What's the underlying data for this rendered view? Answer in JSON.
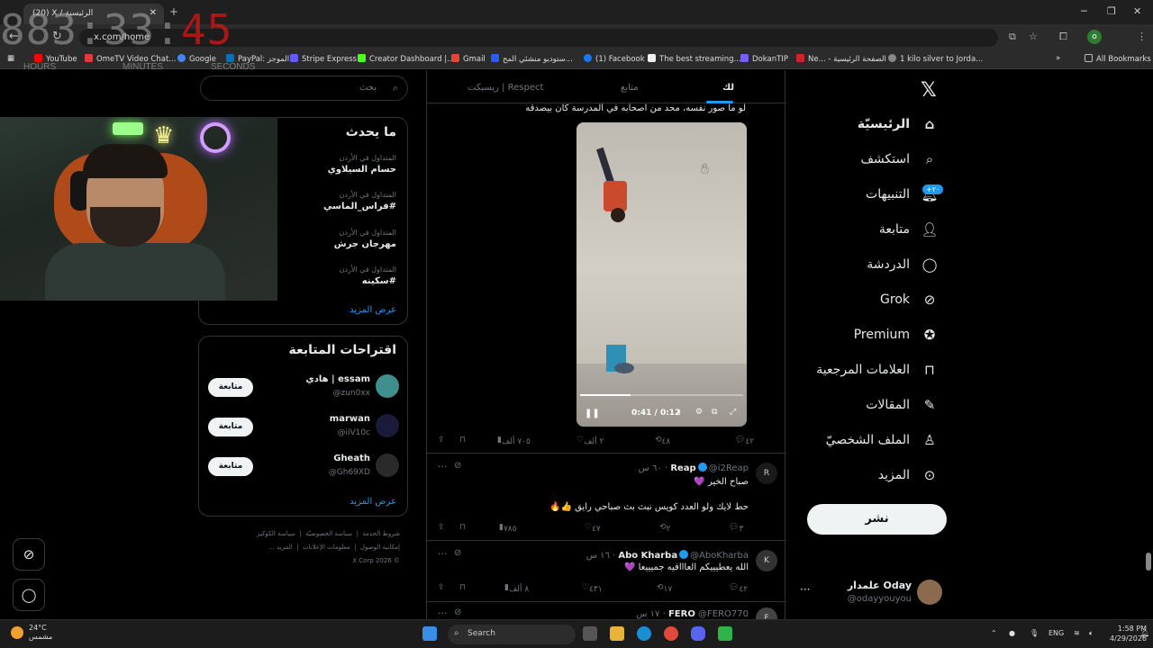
{
  "browser": {
    "tab_title": "(20) X / الرئيسية",
    "url": "x.com/home",
    "bookmarks": [
      "YouTube",
      "OmeTV Video Chat...",
      "Google",
      "PayPal: الموجز",
      "Stripe Express",
      "Creator Dashboard |...",
      "Gmail",
      "ستوديو منشئي المح...",
      "(1) Facebook",
      "The best streaming...",
      "DokanTIP",
      "Ne... - الصفحة الرئيسية",
      "1 kilo silver to Jorda..."
    ],
    "all_bookmarks": "All Bookmarks",
    "profile_letter": "o"
  },
  "timer": {
    "hm": "883:33:",
    "sec": "45",
    "labels": [
      "HOURS",
      "MINUTES",
      "SECONDS"
    ]
  },
  "nav": {
    "items": [
      "الرئيسيّة",
      "استكشف",
      "التنبيهات",
      "متابعة",
      "الدردشة",
      "Grok",
      "Premium",
      "العلامات المرجعية",
      "المقالات",
      "الملف الشخصيّ",
      "المزيد"
    ],
    "notif_badge": "+٢٠",
    "post_button": "نشر",
    "account_name": "علمدار Oday",
    "account_handle": "@odayyouyou"
  },
  "feed": {
    "tabs": [
      "لك",
      "متابع",
      "ريسبكت | Respect"
    ],
    "caption": "لو ما صور نفسه، محد من اصحابه في المدرسة كان بيصدقه",
    "video_time": "0:41 / 0:12",
    "tweet1_stats": {
      "replies": "٤٢",
      "reposts": "٤٨",
      "likes": "٢ ألف",
      "views": "٧٠٥ ألف"
    },
    "tweets": [
      {
        "name": "Reap",
        "handle": "@i2Reap · ٦٠ س",
        "avatar": "R",
        "lines": [
          "صباح الخير 💜",
          "حط لايك ولو العدد كويس نبث بث صباحي رايق 👍🔥"
        ],
        "stats": {
          "replies": "٣",
          "reposts": "٢",
          "likes": "٤٧",
          "views": "٧٨٥"
        }
      },
      {
        "name": "Abo Kharba",
        "handle": "@AboKharba · ١٦ س",
        "avatar": "K",
        "lines": [
          "الله يعطيييكم العااافيه جميييعا 💜"
        ],
        "stats": {
          "replies": "٤٢",
          "reposts": "١٧",
          "likes": "٤٣١",
          "views": "٨ ألف"
        }
      },
      {
        "name": "FERO",
        "handle": "@FERO770 · ١٧ س",
        "avatar": "F",
        "lines": [],
        "stats": {}
      }
    ]
  },
  "sidebar": {
    "search_placeholder": "بحث",
    "trends_title": "ما يحدث",
    "trends": [
      {
        "context": "المتداول في الأردن",
        "topic": "حسام السيلاوي"
      },
      {
        "context": "المتداول في الأردن",
        "topic": "#فراس_الماسي"
      },
      {
        "context": "المتداول في الأردن",
        "topic": "مهرجان جرش"
      },
      {
        "context": "المتداول في الأردن",
        "topic": "#سكينه"
      }
    ],
    "show_more": "عرض المزيد",
    "who_title": "اقتراحات المتابعة",
    "suggestions": [
      {
        "name": "essam | هادي",
        "handle": "@zun0xx",
        "button": "متابعة"
      },
      {
        "name": "marwan",
        "handle": "@iiV10c",
        "button": "متابعة"
      },
      {
        "name": "Gheath",
        "handle": "@Gh69XD",
        "button": "متابعة"
      }
    ],
    "footer": [
      "شروط الخدمة",
      "سياسة الخصوصيّة",
      "سياسة الكوكيز",
      "إمكانية الوصول",
      "معلومات الإعلانات",
      "المزيد ...",
      "© X Corp 2026"
    ]
  },
  "taskbar": {
    "temp": "24°C",
    "weather": "مشمس",
    "search": "Search",
    "lang": "ENG",
    "time": "1:58 PM",
    "date": "4/29/2026"
  }
}
